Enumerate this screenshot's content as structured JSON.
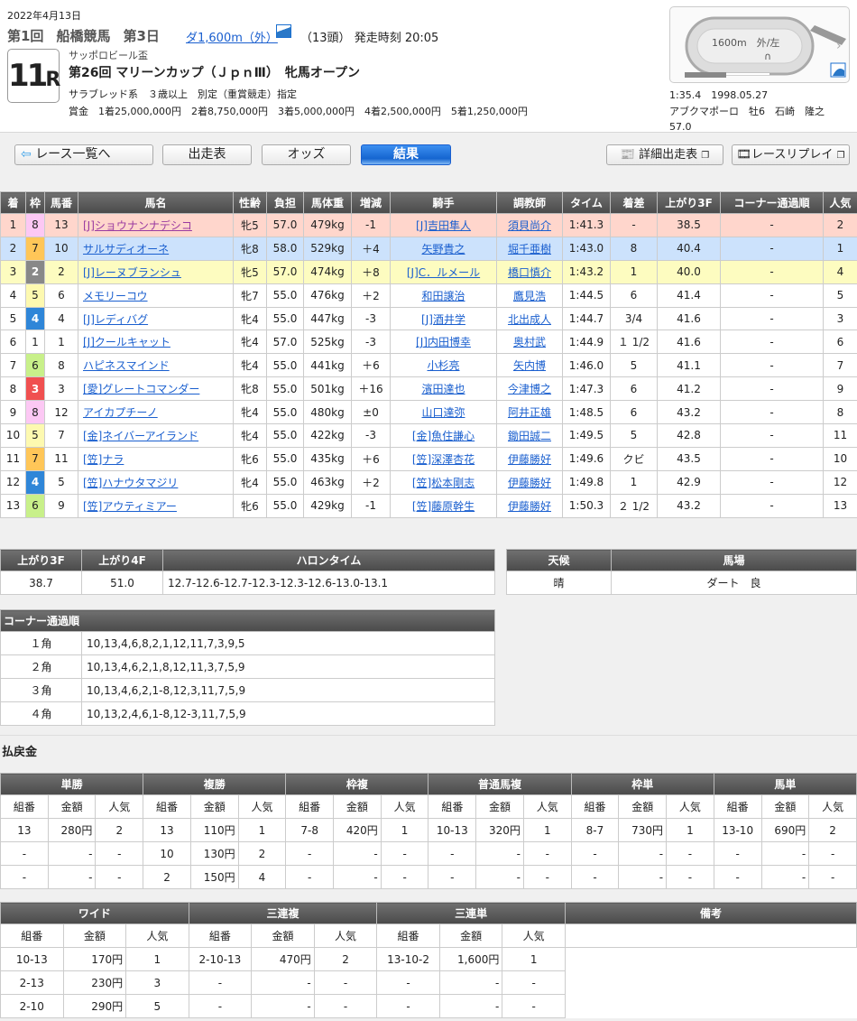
{
  "header": {
    "date": "2022年4月13日",
    "meeting": [
      "第1回",
      "船橋競馬",
      "第3日"
    ],
    "distance": "ダ1,600m（外）",
    "heads": "（13頭）",
    "post_time": "発走時刻 20:05",
    "race_no": "11",
    "race_no_suffix": "R",
    "sponsor": "サッポロビール盃",
    "race_name": "第26回 マリーンカップ（ＪｐｎⅢ）　牝馬オープン",
    "conditions": "サラブレッド系　３歳以上　別定（重賞競走）指定",
    "prize": "賞金　1着25,000,000円　2着8,750,000円　3着5,000,000円　4着2,500,000円　5着1,250,000円"
  },
  "course": {
    "label": "1600m　外/左",
    "record_time": "1:35.4　1998.05.27",
    "record_horse": "アブクマポーロ　牡6　石崎　隆之",
    "record_weight": "57.0"
  },
  "nav": {
    "back": "レース一覧へ",
    "entries": "出走表",
    "odds": "オッズ",
    "results": "結果",
    "detail_entries": "詳細出走表",
    "replay": "レースリプレイ"
  },
  "results": {
    "headers": [
      "着",
      "枠",
      "馬番",
      "馬名",
      "性齢",
      "負担",
      "馬体重",
      "増減",
      "騎手",
      "調教師",
      "タイム",
      "着差",
      "上がり3F",
      "コーナー通過順",
      "人気"
    ],
    "rows": [
      [
        "1",
        "8",
        "13",
        "[J]ショウナンナデシコ",
        "牝5",
        "57.0",
        "479kg",
        "-1",
        "[J]吉田隼人",
        "須貝尚介",
        "1:41.3",
        "-",
        "38.5",
        "-",
        "2"
      ],
      [
        "2",
        "7",
        "10",
        "サルサディオーネ",
        "牝8",
        "58.0",
        "529kg",
        "＋4",
        "矢野貴之",
        "堀千亜樹",
        "1:43.0",
        "8",
        "40.4",
        "-",
        "1"
      ],
      [
        "3",
        "2",
        "2",
        "[J]レーヌブランシュ",
        "牝5",
        "57.0",
        "474kg",
        "＋8",
        "[J]C．ルメール",
        "橋口慎介",
        "1:43.2",
        "1",
        "40.0",
        "-",
        "4"
      ],
      [
        "4",
        "5",
        "6",
        "メモリーコウ",
        "牝7",
        "55.0",
        "476kg",
        "＋2",
        "和田譲治",
        "鷹見浩",
        "1:44.5",
        "6",
        "41.4",
        "-",
        "5"
      ],
      [
        "5",
        "4",
        "4",
        "[J]レディバグ",
        "牝4",
        "55.0",
        "447kg",
        "-3",
        "[J]酒井学",
        "北出成人",
        "1:44.7",
        "3/4",
        "41.6",
        "-",
        "3"
      ],
      [
        "6",
        "1",
        "1",
        "[J]クールキャット",
        "牝4",
        "57.0",
        "525kg",
        "-3",
        "[J]内田博幸",
        "奥村武",
        "1:44.9",
        "１ 1/2",
        "41.6",
        "-",
        "6"
      ],
      [
        "7",
        "6",
        "8",
        "ハピネスマインド",
        "牝4",
        "55.0",
        "441kg",
        "＋6",
        "小杉亮",
        "矢内博",
        "1:46.0",
        "5",
        "41.1",
        "-",
        "7"
      ],
      [
        "8",
        "3",
        "3",
        "[愛]グレートコマンダー",
        "牝8",
        "55.0",
        "501kg",
        "＋16",
        "濱田達也",
        "今津博之",
        "1:47.3",
        "6",
        "41.2",
        "-",
        "9"
      ],
      [
        "9",
        "8",
        "12",
        "アイカプチーノ",
        "牝4",
        "55.0",
        "480kg",
        "±0",
        "山口達弥",
        "阿井正雄",
        "1:48.5",
        "6",
        "43.2",
        "-",
        "8"
      ],
      [
        "10",
        "5",
        "7",
        "[金]ネイバーアイランド",
        "牝4",
        "55.0",
        "422kg",
        "-3",
        "[金]魚住謙心",
        "鋤田誠二",
        "1:49.5",
        "5",
        "42.8",
        "-",
        "11"
      ],
      [
        "11",
        "7",
        "11",
        "[笠]ナラ",
        "牝6",
        "55.0",
        "435kg",
        "＋6",
        "[笠]深澤杏花",
        "伊藤勝好",
        "1:49.6",
        "クビ",
        "43.5",
        "-",
        "10"
      ],
      [
        "12",
        "4",
        "5",
        "[笠]ハナウタマジリ",
        "牝4",
        "55.0",
        "463kg",
        "＋2",
        "[笠]松本剛志",
        "伊藤勝好",
        "1:49.8",
        "1",
        "42.9",
        "-",
        "12"
      ],
      [
        "13",
        "6",
        "9",
        "[笠]アウティミアー",
        "牝6",
        "55.0",
        "429kg",
        "-1",
        "[笠]藤原幹生",
        "伊藤勝好",
        "1:50.3",
        "２ 1/2",
        "43.2",
        "-",
        "13"
      ]
    ]
  },
  "waku_colors": {
    "1": "#ffffff",
    "2": "#888888",
    "3": "#f05050",
    "4": "#2f86d8",
    "5": "#fdf9b0",
    "6": "#c8f08a",
    "7": "#ffc658",
    "8": "#fcc8f4"
  },
  "place_colors": [
    "#ffd6cc",
    "#cce2fc",
    "#fdfcc0"
  ],
  "laps": {
    "headers": [
      "上がり3F",
      "上がり4F",
      "ハロンタイム"
    ],
    "values": [
      "38.7",
      "51.0",
      "12.7-12.6-12.7-12.3-12.3-12.6-13.0-13.1"
    ]
  },
  "track": {
    "headers": [
      "天候",
      "馬場"
    ],
    "values": [
      "晴",
      "ダート　良"
    ]
  },
  "corners": {
    "title": "コーナー通過順",
    "rows": [
      [
        "１角",
        "10,13,4,6,8,2,1,12,11,7,3,9,5"
      ],
      [
        "２角",
        "10,13,4,6,2,1,8,12,11,3,7,5,9"
      ],
      [
        "３角",
        "10,13,4,6,2,1-8,12,3,11,7,5,9"
      ],
      [
        "４角",
        "10,13,2,4,6,1-8,12-3,11,7,5,9"
      ]
    ]
  },
  "payout": {
    "title": "払戻金",
    "sub": [
      "組番",
      "金額",
      "人気"
    ],
    "groups1": [
      {
        "name": "単勝",
        "rows": [
          [
            "13",
            "280円",
            "2"
          ],
          [
            "-",
            "-",
            "-"
          ],
          [
            "-",
            "-",
            "-"
          ]
        ]
      },
      {
        "name": "複勝",
        "rows": [
          [
            "13",
            "110円",
            "1"
          ],
          [
            "10",
            "130円",
            "2"
          ],
          [
            "2",
            "150円",
            "4"
          ]
        ]
      },
      {
        "name": "枠複",
        "rows": [
          [
            "7-8",
            "420円",
            "1"
          ],
          [
            "-",
            "-",
            "-"
          ],
          [
            "-",
            "-",
            "-"
          ]
        ]
      },
      {
        "name": "普通馬複",
        "rows": [
          [
            "10-13",
            "320円",
            "1"
          ],
          [
            "-",
            "-",
            "-"
          ],
          [
            "-",
            "-",
            "-"
          ]
        ]
      },
      {
        "name": "枠単",
        "rows": [
          [
            "8-7",
            "730円",
            "1"
          ],
          [
            "-",
            "-",
            "-"
          ],
          [
            "-",
            "-",
            "-"
          ]
        ]
      },
      {
        "name": "馬単",
        "rows": [
          [
            "13-10",
            "690円",
            "2"
          ],
          [
            "-",
            "-",
            "-"
          ],
          [
            "-",
            "-",
            "-"
          ]
        ]
      }
    ],
    "groups2": [
      {
        "name": "ワイド",
        "rows": [
          [
            "10-13",
            "170円",
            "1"
          ],
          [
            "2-13",
            "230円",
            "3"
          ],
          [
            "2-10",
            "290円",
            "5"
          ]
        ]
      },
      {
        "name": "三連複",
        "rows": [
          [
            "2-10-13",
            "470円",
            "2"
          ],
          [
            "-",
            "-",
            "-"
          ],
          [
            "-",
            "-",
            "-"
          ]
        ]
      },
      {
        "name": "三連単",
        "rows": [
          [
            "13-10-2",
            "1,600円",
            "1"
          ],
          [
            "-",
            "-",
            "-"
          ],
          [
            "-",
            "-",
            "-"
          ]
        ]
      }
    ],
    "remarks": "備考"
  }
}
